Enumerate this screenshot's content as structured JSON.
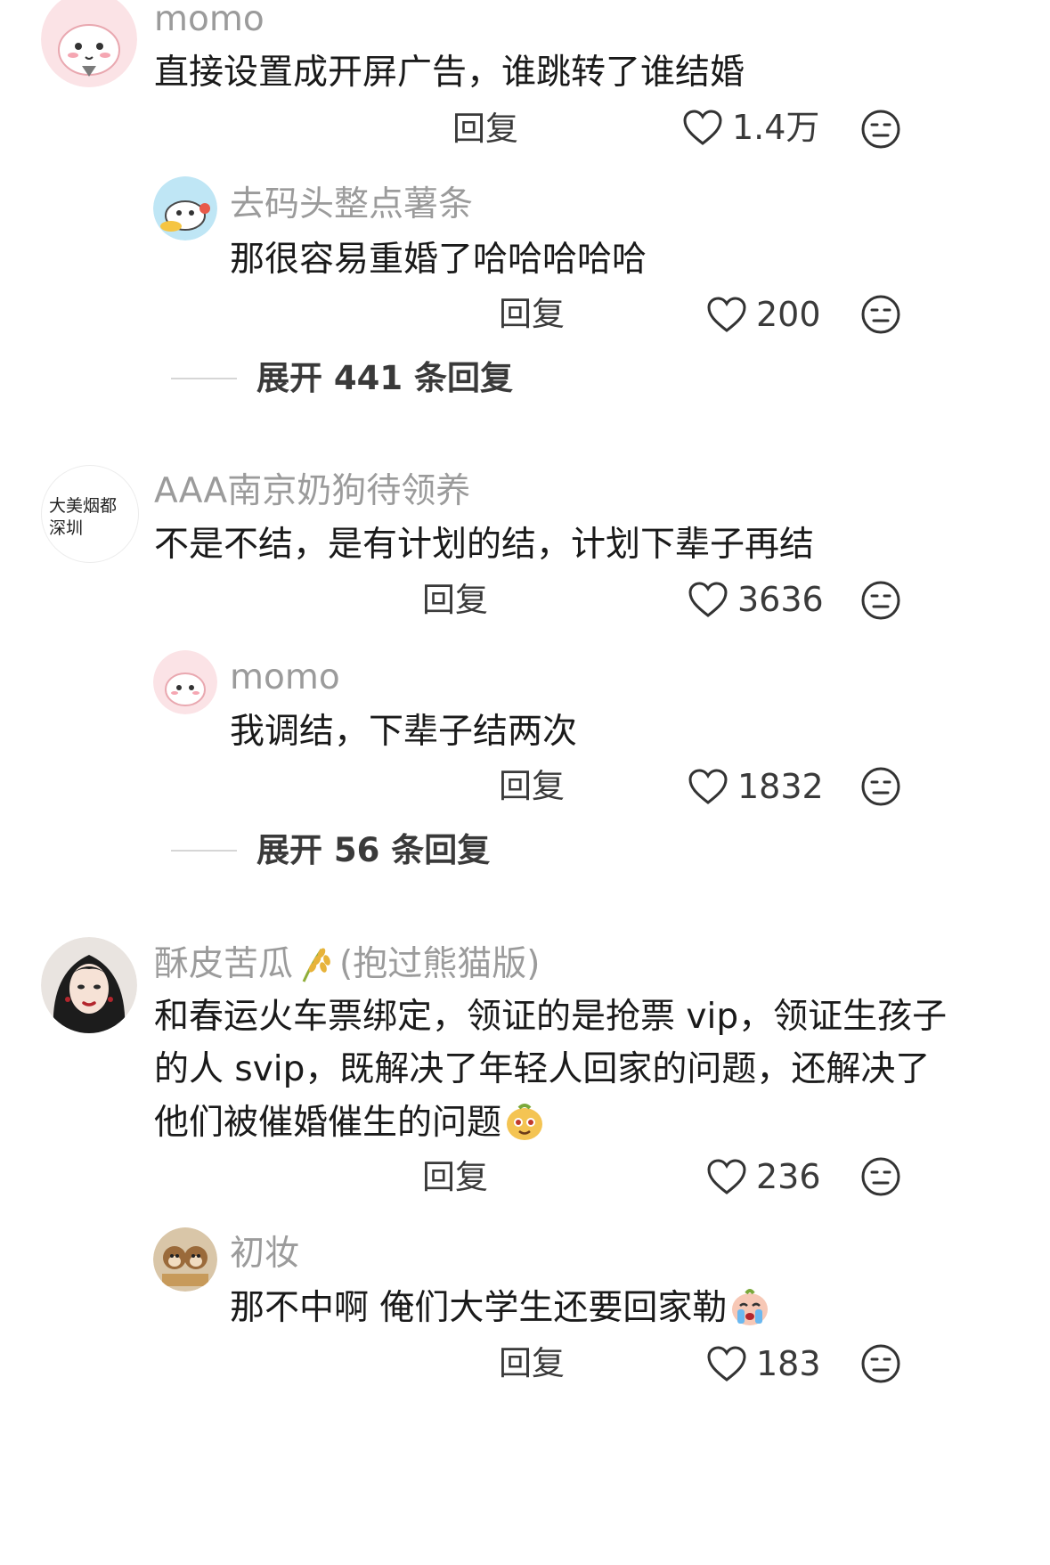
{
  "comments": [
    {
      "username": "momo",
      "text": "直接设置成开屏广告，谁跳转了谁结婚",
      "reply_label": "回复",
      "likes": "1.4万",
      "avatar_icon": "pink-cat-avatar-icon",
      "replies": [
        {
          "username": "去码头整点薯条",
          "text": "那很容易重婚了哈哈哈哈哈",
          "reply_label": "回复",
          "likes": "200",
          "avatar_icon": "blue-cat-avatar-icon"
        }
      ],
      "expand_label": "展开 441 条回复"
    },
    {
      "username": "AAA南京奶狗待领养",
      "avatar_text_line1": "大美烟都",
      "avatar_text_line2": "深圳",
      "text": "不是不结，是有计划的结，计划下辈子再结",
      "reply_label": "回复",
      "likes": "3636",
      "replies": [
        {
          "username": "momo",
          "text": "我调结，下辈子结两次",
          "reply_label": "回复",
          "likes": "1832",
          "avatar_icon": "pink-cat-avatar-icon"
        }
      ],
      "expand_label": "展开 56 条回复"
    },
    {
      "username": "酥皮苦瓜",
      "username_suffix": "(抱过熊猫版)",
      "badge_icon": "wheat-icon",
      "text_lines": [
        "和春运火车票绑定，领证的是抢票 vip，领证生孩子",
        "的人 svip，既解决了年轻人回家的问题，还解决了",
        "他们被催婚催生的问题"
      ],
      "reply_label": "回复",
      "likes": "236",
      "avatar_icon": "woman-portrait-avatar-icon",
      "replies": [
        {
          "username": "初妆",
          "text": "那不中啊 俺们大学生还要回家勒",
          "reply_label": "回复",
          "likes": "183",
          "avatar_icon": "chipmunk-avatar-icon"
        }
      ]
    }
  ],
  "colors": {
    "username": "#9b9b9b",
    "text": "#1a1a1a",
    "secondary": "#3a3a3a",
    "divider": "#d6d6d6"
  }
}
